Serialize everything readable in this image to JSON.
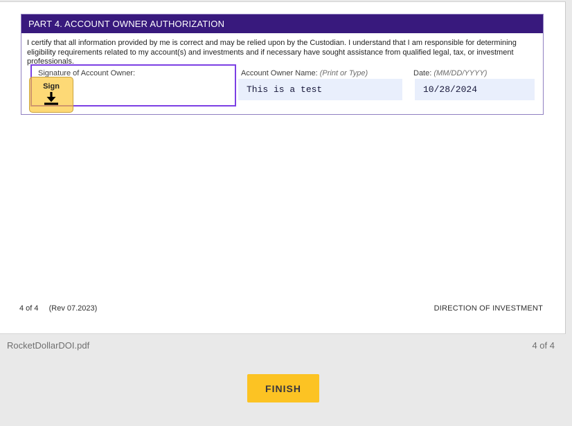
{
  "document": {
    "part4": {
      "header": "PART 4. ACCOUNT OWNER AUTHORIZATION",
      "certify_text": "I certify that all information provided by me is correct and may be relied upon by the Custodian. I understand that I am responsible for determining eligibility requirements related to my account(s) and investments and if necessary have sought assistance from qualified legal, tax, or investment professionals."
    },
    "signature_field": {
      "label": "Signature of Account Owner:",
      "sign_tag_label": "Sign",
      "sign_tag_icon": "arrow-down-to-line-icon"
    },
    "name_field": {
      "label": "Account Owner Name:",
      "hint": "(Print or Type)",
      "value": "This is a test"
    },
    "date_field": {
      "label": "Date:",
      "hint": "(MM/DD/YYYY)",
      "value": "10/28/2024"
    },
    "footer": {
      "page_info": "4 of 4",
      "revision": "(Rev 07.2023)",
      "title": "DIRECTION OF INVESTMENT"
    }
  },
  "viewer": {
    "file_name": "RocketDollarDOI.pdf",
    "page_indicator": "4 of 4",
    "finish_label": "FINISH"
  },
  "colors": {
    "section_header_bg": "#38197d",
    "section_border": "#8f7fc0",
    "signature_field_border": "#7b3fe4",
    "sign_tag_bg": "#fcc62f",
    "input_highlight_bg": "#e9effc",
    "finish_button_bg": "#fcc323",
    "viewer_bg": "#e9e9e9"
  }
}
